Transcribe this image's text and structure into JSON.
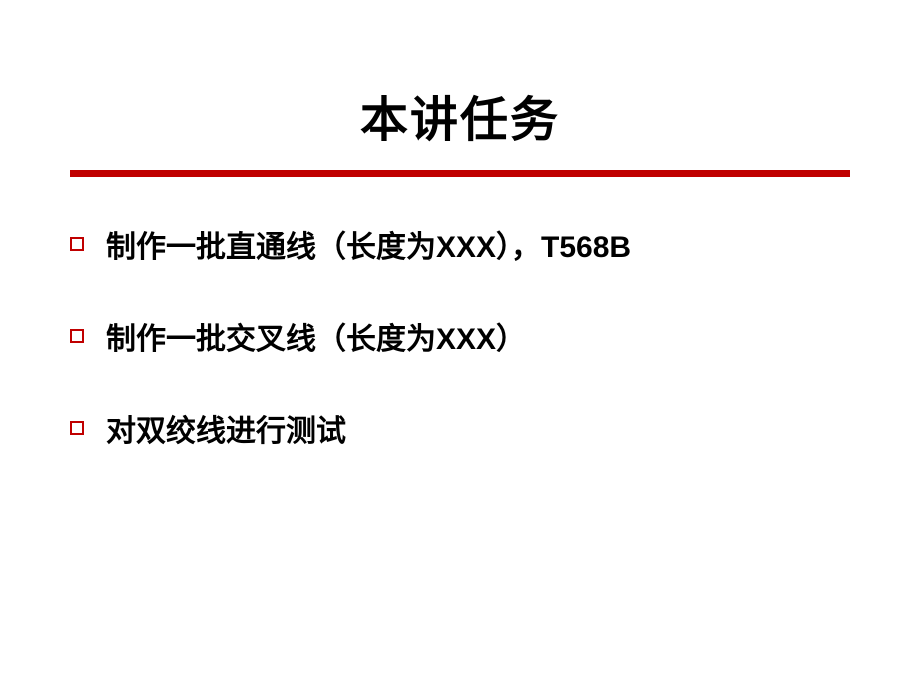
{
  "title": "本讲任务",
  "bullets": [
    {
      "text": "制作一批直通线（长度为XXX），T568B"
    },
    {
      "text": "制作一批交叉线（长度为XXX）"
    },
    {
      "text": "对双绞线进行测试"
    }
  ]
}
